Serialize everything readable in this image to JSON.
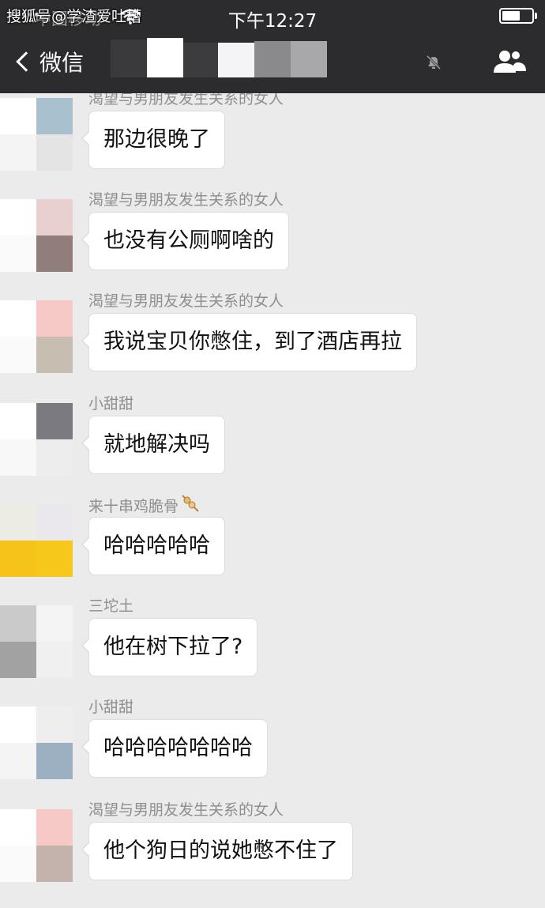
{
  "status_bar": {
    "carrier": "中国移动",
    "watermark": "搜狐号@学渣爱吐槽",
    "time": "下午12:27",
    "battery_level": 0.6
  },
  "nav": {
    "back_label": "微信",
    "icons": [
      "chevron-left-icon",
      "mute-icon",
      "group-icon"
    ]
  },
  "messages": [
    {
      "sender": "渴望与男朋友发生关系的女人",
      "text": "那边很晚了",
      "avatar_colors": [
        "#ffffff",
        "#a9c1cf",
        "#f4f4f4",
        "#e4e4e4"
      ]
    },
    {
      "sender": "渴望与男朋友发生关系的女人",
      "text": "也没有公厕啊啥的",
      "avatar_colors": [
        "#ffffff",
        "#e8d0ce",
        "#fafafa",
        "#917e7b"
      ]
    },
    {
      "sender": "渴望与男朋友发生关系的女人",
      "text": "我说宝贝你憋住，到了酒店再拉",
      "avatar_colors": [
        "#ffffff",
        "#f6c9c7",
        "#fafafa",
        "#c8bdb1"
      ]
    },
    {
      "sender": "小甜甜",
      "text": "就地解决吗",
      "avatar_colors": [
        "#ffffff",
        "#7b7a80",
        "#f8f8f8",
        "#ededed"
      ]
    },
    {
      "sender": "来十串鸡脆骨",
      "text": "哈哈哈哈哈",
      "avatar_colors": [
        "#ecebe4",
        "#eae8ec",
        "#f6c31a",
        "#f6c81c"
      ],
      "sender_icon": "skewer-icon"
    },
    {
      "sender": "三坨土",
      "text": "他在树下拉了?",
      "avatar_colors": [
        "#cacaca",
        "#f4f4f4",
        "#a2a2a2",
        "#f0f0f0"
      ]
    },
    {
      "sender": "小甜甜",
      "text": "哈哈哈哈哈哈哈",
      "avatar_colors": [
        "#ffffff",
        "#eeeeee",
        "#f4f4f4",
        "#9db0c1"
      ]
    },
    {
      "sender": "渴望与男朋友发生关系的女人",
      "text": "他个狗日的说她憋不住了",
      "avatar_colors": [
        "#ffffff",
        "#f6c8c6",
        "#fafafa",
        "#c4b2ac"
      ]
    }
  ],
  "colors": {
    "header_bg": "#2c2c2e",
    "chat_bg": "#ebebeb",
    "bubble_bg": "#ffffff",
    "sender_text": "#8e8e8e"
  }
}
